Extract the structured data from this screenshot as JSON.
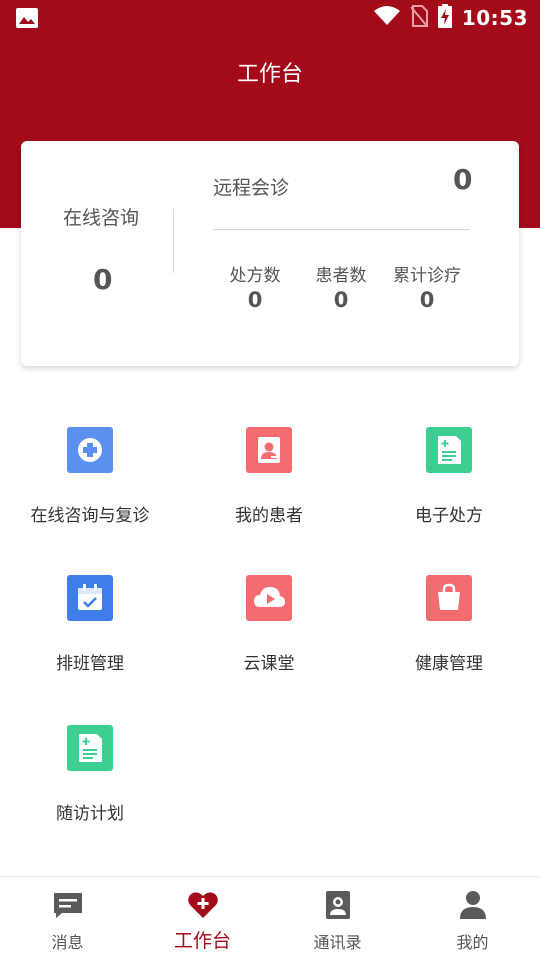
{
  "status_bar": {
    "time": "10:53",
    "icons": [
      "gallery-icon",
      "wifi-icon",
      "no-sim-icon",
      "battery-charging-icon"
    ]
  },
  "header": {
    "title": "工作台"
  },
  "summary": {
    "online_consult": {
      "label": "在线咨询",
      "value": "0"
    },
    "remote_consult": {
      "label": "远程会诊",
      "value": "0"
    },
    "stats": [
      {
        "label": "处方数",
        "value": "0"
      },
      {
        "label": "患者数",
        "value": "0"
      },
      {
        "label": "累计诊疗",
        "value": "0"
      }
    ]
  },
  "grid": [
    {
      "label": "在线咨询与复诊",
      "icon": "medical-cross-icon",
      "color": "#5b8ff0"
    },
    {
      "label": "我的患者",
      "icon": "patient-card-icon",
      "color": "#f46b70"
    },
    {
      "label": "电子处方",
      "icon": "prescription-icon",
      "color": "#3ccf91"
    },
    {
      "label": "排班管理",
      "icon": "calendar-check-icon",
      "color": "#3f7ee8"
    },
    {
      "label": "云课堂",
      "icon": "cloud-play-icon",
      "color": "#f46b70"
    },
    {
      "label": "健康管理",
      "icon": "bag-icon",
      "color": "#f46b70"
    },
    {
      "label": "随访计划",
      "icon": "followup-document-icon",
      "color": "#3ccf91"
    }
  ],
  "tabbar": {
    "active": 1,
    "accent_color": "#a30b1b",
    "items": [
      {
        "label": "消息",
        "icon": "message-icon"
      },
      {
        "label": "工作台",
        "icon": "heart-plus-icon"
      },
      {
        "label": "通讯录",
        "icon": "contacts-icon"
      },
      {
        "label": "我的",
        "icon": "person-icon"
      }
    ]
  }
}
